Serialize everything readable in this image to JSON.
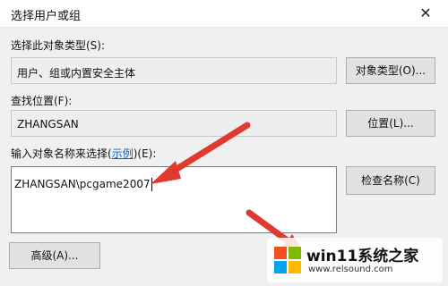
{
  "window": {
    "title": "选择用户或组"
  },
  "object_type": {
    "label": "选择此对象类型(S):",
    "value": "用户、组或内置安全主体",
    "button_label": "对象类型(O)..."
  },
  "location": {
    "label": "查找位置(F):",
    "value": "ZHANGSAN",
    "button_label": "位置(L)..."
  },
  "names": {
    "label_prefix": "输入对象名称来选择(",
    "examples_link": "示例",
    "label_suffix": ")(E):",
    "value": "ZHANGSAN\\pcgame2007",
    "check_button_label": "检查名称(C)"
  },
  "advanced_button_label": "高级(A)...",
  "watermark": {
    "name": "win11系统之家",
    "url": "www.relsound.com"
  },
  "colors": {
    "arrow": "#e03a2f",
    "link": "#0066cc"
  }
}
